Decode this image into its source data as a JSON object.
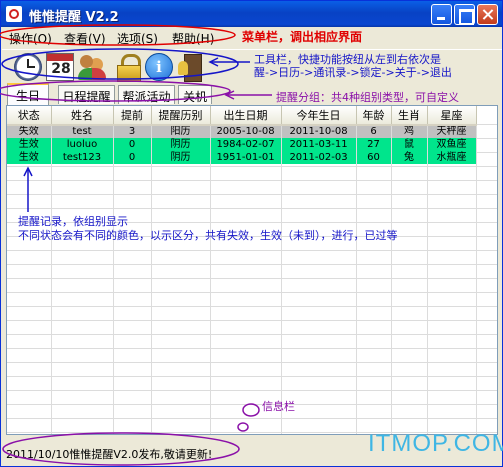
{
  "window": {
    "title": "惟惟提醒 V2.2"
  },
  "menu": [
    {
      "label": "操作(O)"
    },
    {
      "label": "查看(V)"
    },
    {
      "label": "选项(S)"
    },
    {
      "label": "帮助(H)"
    }
  ],
  "toolbar": {
    "calendar_number": "28",
    "info_letter": "i",
    "icons": [
      "clock-icon",
      "calendar-icon",
      "contacts-icon",
      "lock-icon",
      "info-icon",
      "exit-icon"
    ]
  },
  "tabs": [
    {
      "label": "生日",
      "active": true
    },
    {
      "label": "日程提醒",
      "active": false
    },
    {
      "label": "帮派活动",
      "active": false
    },
    {
      "label": "关机",
      "active": false
    }
  ],
  "table": {
    "columns": [
      "状态",
      "姓名",
      "提前",
      "提醒历别",
      "出生日期",
      "今年生日",
      "年龄",
      "生肖",
      "星座"
    ],
    "rows": [
      {
        "type": "invalid",
        "cells": [
          "失效",
          "test",
          "3",
          "阳历",
          "2005-10-08",
          "2011-10-08",
          "6",
          "鸡",
          "天秤座"
        ]
      },
      {
        "type": "valid",
        "cells": [
          "生效",
          "luoluo",
          "0",
          "阴历",
          "1984-02-07",
          "2011-03-11",
          "27",
          "鼠",
          "双鱼座"
        ]
      },
      {
        "type": "valid",
        "cells": [
          "生效",
          "test123",
          "0",
          "阴历",
          "1951-01-01",
          "2011-02-03",
          "60",
          "兔",
          "水瓶座"
        ]
      }
    ]
  },
  "status": {
    "text": "2011/10/10惟惟提醒V2.0发布,敬请更新!"
  },
  "annotations": {
    "menubar": "菜单栏，调出相应界面",
    "toolbar_line1": "工具栏，快捷功能按纽从左到右依次是",
    "toolbar_line2": "醒->日历->通讯录->锁定->关于->退出",
    "tabs": "提醒分组：共4种组别类型，可自定义",
    "records_line1": "提醒记录，依组别显示",
    "records_line2": "不同状态会有不同的颜色，以示区分，共有失效，生效（未到），进行，已过等",
    "infobar": "信息栏"
  },
  "watermark": "ITMOP.COM",
  "colors": {
    "invalid_row": "#c0c0c0",
    "valid_row": "#00e58c",
    "annotation_red": "#e00000",
    "annotation_blue": "#1515c8",
    "annotation_purple": "#8a10a8",
    "watermark": "#3fb6e4"
  }
}
